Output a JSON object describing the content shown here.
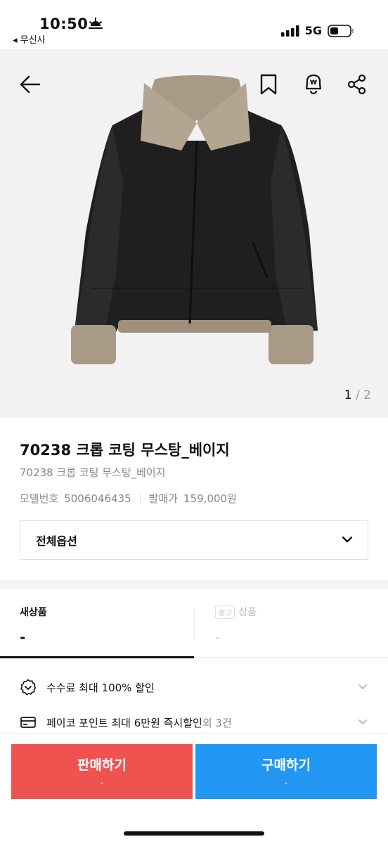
{
  "status_bar": {
    "time": "10:50",
    "back_app": "◂ 무신사",
    "network": "5G"
  },
  "hero": {
    "page_current": "1",
    "page_separator": " / ",
    "page_total": "2",
    "icons": [
      "back-arrow-icon",
      "bookmark-icon",
      "price-alert-icon",
      "share-icon"
    ]
  },
  "product": {
    "title": "70238 크롭 코팅 무스탕_베이지",
    "subtitle": "70238 크롭 코팅 무스탕_베이지",
    "model_label": "모델번호",
    "model_value": "5006046435",
    "release_label": "발매가",
    "release_value": "159,000원"
  },
  "option_select": {
    "label": "전체옵션"
  },
  "tabs": {
    "new_label": "새상품",
    "new_price": "-",
    "used_badge": "중고",
    "used_label": "상품",
    "used_price": "-"
  },
  "benefits": [
    {
      "text": "수수료 최대 100% 할인",
      "extra": ""
    },
    {
      "text": "페이코 포인트 최대 6만원 즉시할인",
      "extra": " 외 3건"
    }
  ],
  "cta": {
    "sell_label": "판매하기",
    "sell_sub": "-",
    "buy_label": "구매하기",
    "buy_sub": "-"
  },
  "colors": {
    "sell": "#ef5350",
    "buy": "#2196f3",
    "fur": "#a89a86",
    "leather": "#1e1e1e"
  }
}
